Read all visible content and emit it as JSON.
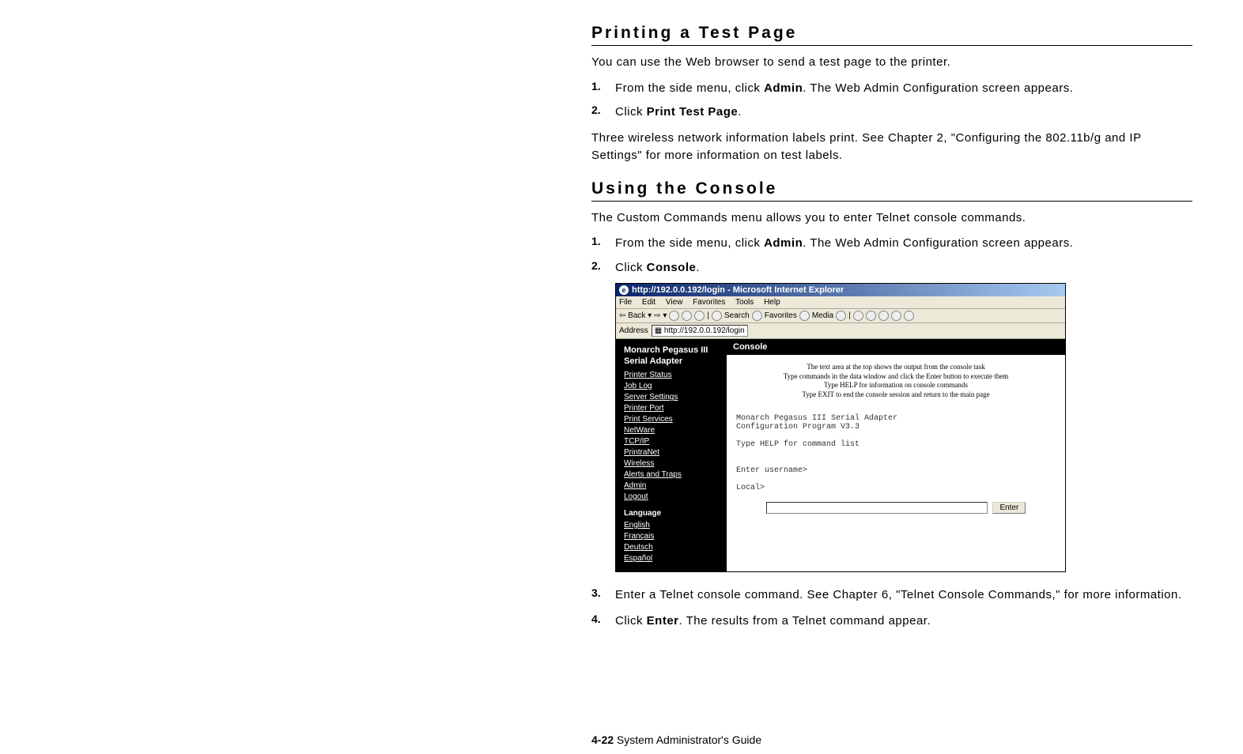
{
  "section1": {
    "heading": "Printing a Test Page",
    "intro": "You can use the Web browser to send a test page to the printer.",
    "step1_num": "1.",
    "step1_a": "From the side menu, click ",
    "step1_bold": "Admin",
    "step1_b": ".  The Web Admin Configuration screen appears.",
    "step2_num": "2.",
    "step2_a": "Click ",
    "step2_bold": "Print Test Page",
    "step2_b": ".",
    "outro": "Three wireless network information labels print.  See Chapter 2, \"Configuring the 802.11b/g and IP Settings\" for more information on test labels."
  },
  "section2": {
    "heading": "Using the Console",
    "intro": "The Custom Commands menu allows you to enter Telnet console commands.",
    "step1_num": "1.",
    "step1_a": "From the side menu, click ",
    "step1_bold": "Admin",
    "step1_b": ".  The Web Admin Configuration screen appears.",
    "step2_num": "2.",
    "step2_a": "Click ",
    "step2_bold": "Console",
    "step2_b": ".",
    "step3_num": "3.",
    "step3_a": "Enter a Telnet console command.  See Chapter 6, \"Telnet Console Commands,\" for more information.",
    "step4_num": "4.",
    "step4_a": "Click ",
    "step4_bold": "Enter",
    "step4_b": ". The results from a Telnet command appear."
  },
  "ie": {
    "title": "http://192.0.0.192/login - Microsoft Internet Explorer",
    "menu": {
      "file": "File",
      "edit": "Edit",
      "view": "View",
      "fav": "Favorites",
      "tools": "Tools",
      "help": "Help"
    },
    "toolbar": {
      "back": "Back",
      "search": "Search",
      "favorites": "Favorites",
      "media": "Media"
    },
    "addr_label": "Address",
    "addr_value": "http://192.0.0.192/login",
    "sidebar": {
      "title": "Monarch Pegasus III",
      "subtitle": "Serial Adapter",
      "links": [
        "Printer Status",
        "Job Log",
        "Server Settings",
        "Printer Port",
        "Print Services",
        "NetWare",
        "TCP/IP",
        "PrintraNet",
        "Wireless",
        "Alerts and Traps",
        "Admin",
        "Logout"
      ],
      "lang_hdr": "Language",
      "langs": [
        "English",
        "Français",
        "Deutsch",
        "Español"
      ]
    },
    "main": {
      "header": "Console",
      "desc1": "The text area at the top shows the output from the console task",
      "desc2": "Type commands in the data window and click the Enter button to execute them",
      "desc3": "Type HELP for information on console commands",
      "desc4": "Type EXIT to end the console session and return to the main page",
      "line1": "Monarch Pegasus III Serial Adapter",
      "line2": "Configuration Program V3.3",
      "line3": "Type HELP for command list",
      "line4": "Enter username>",
      "line5": "Local>",
      "enter_btn": "Enter"
    }
  },
  "footer": {
    "pagenum": "4-22",
    "label": " System Administrator's Guide"
  }
}
